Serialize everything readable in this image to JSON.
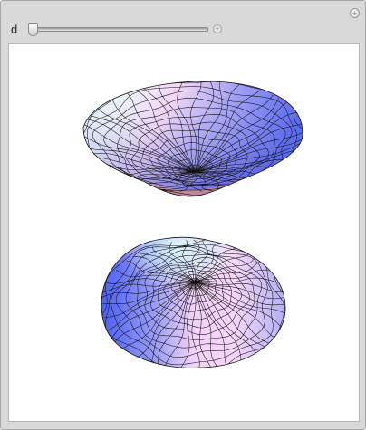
{
  "controls": {
    "parameter_label": "d",
    "slider_value": 0
  },
  "icons": {
    "corner": "plus-circle-icon",
    "slider_expand": "plus-circle-icon"
  },
  "plot": {
    "surfaces": [
      "upper-bowl-surface",
      "lower-dome-surface"
    ],
    "colors": {
      "blue": "#4b5cf2",
      "pink": "#f6d2f8",
      "cyan": "#d9f6fa",
      "mesh": "#111111",
      "rim": "#b07080"
    }
  }
}
